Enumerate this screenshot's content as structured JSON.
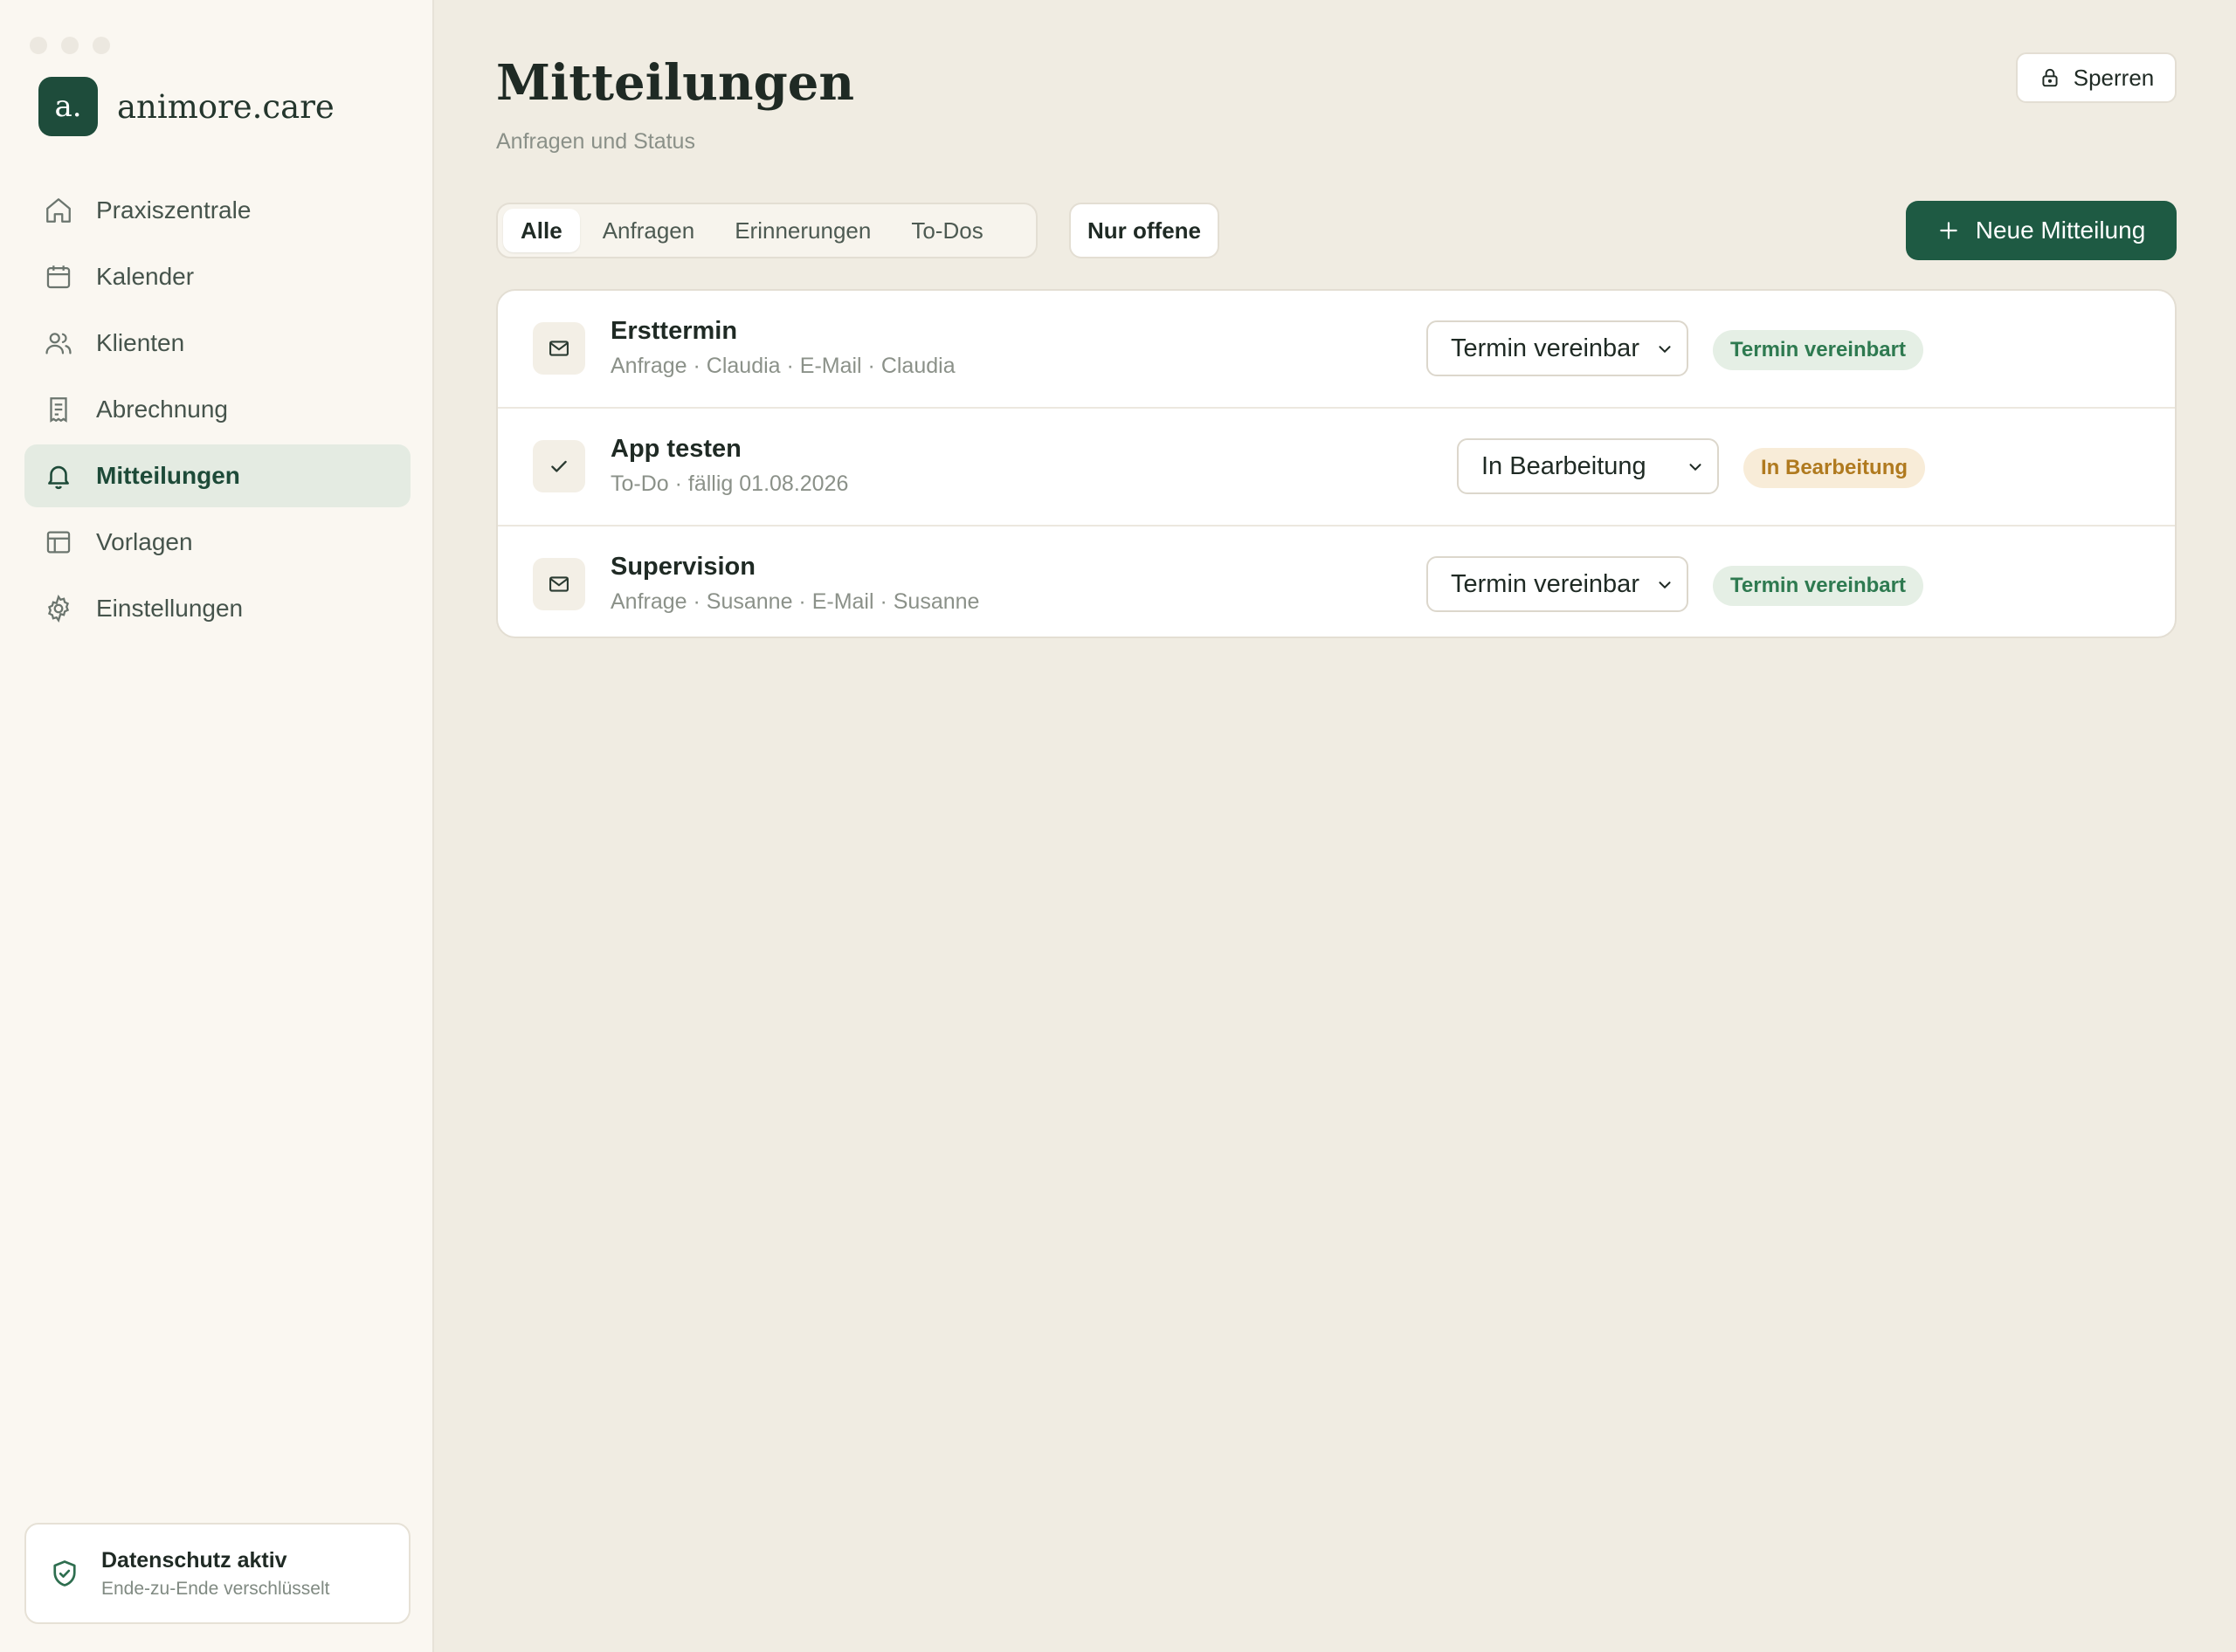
{
  "brand": {
    "logo_text": "a.",
    "name": "animore.care"
  },
  "sidebar": {
    "items": [
      {
        "label": "Praxiszentrale",
        "icon": "home-icon"
      },
      {
        "label": "Kalender",
        "icon": "calendar-icon"
      },
      {
        "label": "Klienten",
        "icon": "users-icon"
      },
      {
        "label": "Abrechnung",
        "icon": "receipt-icon"
      },
      {
        "label": "Mitteilungen",
        "icon": "bell-icon",
        "active": true
      },
      {
        "label": "Vorlagen",
        "icon": "template-icon"
      },
      {
        "label": "Einstellungen",
        "icon": "gear-icon"
      }
    ],
    "privacy": {
      "title": "Datenschutz aktiv",
      "subtitle": "Ende-zu-Ende verschlüsselt"
    }
  },
  "header": {
    "title": "Mitteilungen",
    "subtitle": "Anfragen und Status",
    "lock_label": "Sperren"
  },
  "tabs": [
    {
      "label": "Alle",
      "active": true
    },
    {
      "label": "Anfragen"
    },
    {
      "label": "Erinnerungen"
    },
    {
      "label": "To-Dos"
    }
  ],
  "filter_label": "Nur offene",
  "new_button_label": "Neue Mitteilung",
  "messages": [
    {
      "title": "Ersttermin",
      "meta": "Anfrage · Claudia · E-Mail · Claudia",
      "icon": "mail-icon",
      "status": "Termin vereinbart",
      "badge": "Termin vereinbart",
      "badge_color": "#2e7a50"
    },
    {
      "title": "App testen",
      "meta": "To-Do · fällig 01.08.2026",
      "icon": "check-icon",
      "status": "In Bearbeitung",
      "badge": "In Bearbeitung",
      "badge_color": "#b07a1f"
    },
    {
      "title": "Supervision",
      "meta": "Anfrage · Susanne · E-Mail · Susanne",
      "icon": "mail-icon",
      "status": "Termin vereinbart",
      "badge": "Termin vereinbart",
      "badge_color": "#2e7a50"
    }
  ],
  "colors": {
    "accent": "#1e5a43",
    "background": "#f0ece2",
    "sidebar": "#faf7f1"
  }
}
